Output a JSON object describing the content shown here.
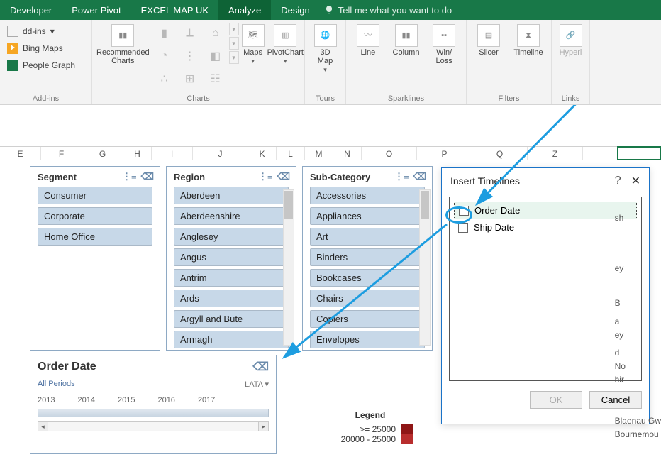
{
  "ribbon": {
    "tabs": [
      "Developer",
      "Power Pivot",
      "EXCEL MAP UK",
      "Analyze",
      "Design"
    ],
    "active_tab": "Analyze",
    "tell_me": "Tell me what you want to do",
    "groups": {
      "addins": {
        "label": "Add-ins",
        "bing": "Bing Maps",
        "people": "People Graph",
        "store_prefix": "dd-ins"
      },
      "charts": {
        "label": "Charts",
        "recommended": "Recommended\nCharts",
        "maps": "Maps",
        "pivot": "PivotChart"
      },
      "tours": {
        "label": "Tours",
        "map3d": "3D\nMap"
      },
      "sparklines": {
        "label": "Sparklines",
        "line": "Line",
        "column": "Column",
        "winloss": "Win/\nLoss"
      },
      "filters": {
        "label": "Filters",
        "slicer": "Slicer",
        "timeline": "Timeline"
      },
      "links": {
        "label": "Links",
        "hyperlink": "Hyperl"
      }
    }
  },
  "columns": [
    "E",
    "F",
    "G",
    "H",
    "I",
    "J",
    "K",
    "L",
    "M",
    "N",
    "O",
    "P",
    "Q",
    "Z"
  ],
  "slicers": {
    "segment": {
      "title": "Segment",
      "items": [
        "Consumer",
        "Corporate",
        "Home Office"
      ]
    },
    "region": {
      "title": "Region",
      "items": [
        "Aberdeen",
        "Aberdeenshire",
        "Anglesey",
        "Angus",
        "Antrim",
        "Ards",
        "Argyll and Bute",
        "Armagh"
      ]
    },
    "subcat": {
      "title": "Sub-Category",
      "items": [
        "Accessories",
        "Appliances",
        "Art",
        "Binders",
        "Bookcases",
        "Chairs",
        "Copiers",
        "Envelopes"
      ]
    }
  },
  "timeline": {
    "title": "Order Date",
    "periods": "All Periods",
    "unit": "LATA",
    "years": [
      "2013",
      "2014",
      "2015",
      "2016",
      "2017"
    ]
  },
  "legend": {
    "title": "Legend",
    "rows": [
      ">=   25000",
      "20000 - 25000"
    ]
  },
  "dialog": {
    "title": "Insert Timelines",
    "help": "?",
    "items": [
      {
        "label": "Order Date",
        "selected": true
      },
      {
        "label": "Ship Date",
        "selected": false
      }
    ],
    "ok": "OK",
    "cancel": "Cancel"
  },
  "edge_words": [
    "sh",
    "ey",
    "B",
    "a",
    "ey",
    "d",
    "No",
    "hir",
    "Blaenau Gw",
    "Bournemou"
  ]
}
